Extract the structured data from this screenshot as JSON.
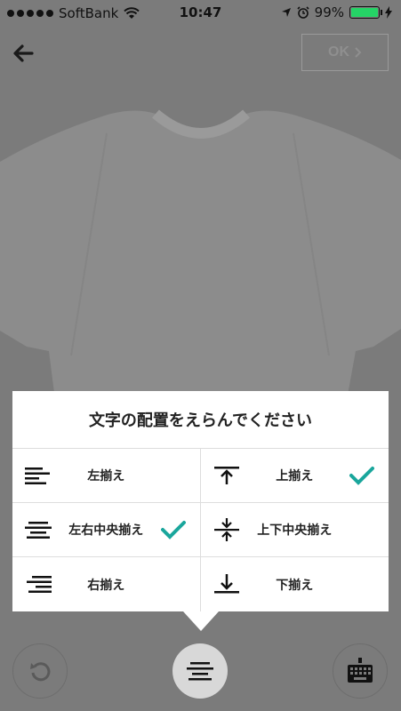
{
  "status_bar": {
    "carrier": "SoftBank",
    "time": "10:47",
    "battery": "99%",
    "battery_level": 0.99
  },
  "nav": {
    "ok_label": "OK"
  },
  "panel": {
    "title": "文字の配置をえらんでください",
    "options": [
      {
        "label": "左揃え",
        "icon": "align-left-icon",
        "selected": false
      },
      {
        "label": "上揃え",
        "icon": "align-top-icon",
        "selected": true
      },
      {
        "label": "左右中央揃え",
        "icon": "align-center-icon",
        "selected": true
      },
      {
        "label": "上下中央揃え",
        "icon": "align-middle-icon",
        "selected": false
      },
      {
        "label": "右揃え",
        "icon": "align-right-icon",
        "selected": false
      },
      {
        "label": "下揃え",
        "icon": "align-bottom-icon",
        "selected": false
      }
    ]
  },
  "toolbar": {
    "items": [
      "refresh-icon",
      "align-center-icon",
      "keyboard-icon"
    ]
  },
  "colors": {
    "accent": "#1aa69c",
    "overlay": "#7b7b7b"
  }
}
